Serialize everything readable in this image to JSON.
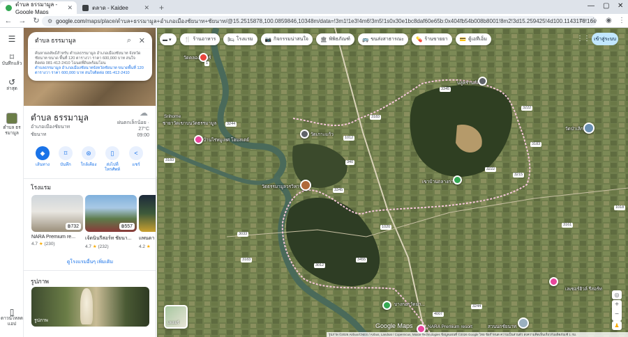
{
  "browser": {
    "tabs": [
      {
        "title": "ตำบล ธรรมามูล - Google Maps",
        "favicon_color": "#34a853",
        "active": true
      },
      {
        "title": "ตลาด - Kaidee",
        "favicon_color": "#3c4043",
        "active": false
      }
    ],
    "new_tab": "+",
    "address": {
      "domain": "google.com",
      "rest": "/maps/place/ตำบล+ธรรมามูล+อำเภอเมืองชัยนาท+ชัยนาท/@15.2515878,100.0859846,10348m/data=!3m1!1e3!4m6!3m5!1s0x30e1bc8daf60e65b:0x404fb54b008b8001!8m2!3d15.259425!4d100.1143176!16s%2Fg%2F1v8syz0r?entry=ttu&g_ep=EgoyMDI..."
    }
  },
  "rail": {
    "menu": "☰",
    "items": [
      {
        "label": "บันทึกแล้ว",
        "icon": "bookmark-icon",
        "glyph": "🔖"
      },
      {
        "label": "ล่าสุด",
        "icon": "history-icon",
        "glyph": "↺"
      },
      {
        "label": "ตำบล ธรรมามูล",
        "icon": "place-thumbnail",
        "glyph": "▣"
      },
      {
        "label": "ดาวน์โหลดแอป",
        "icon": "phone-icon",
        "glyph": "▯"
      }
    ]
  },
  "search": {
    "query": "ตำบล ธรรมามูล",
    "suggestion_line1": "ค้นหาผลลัพธ์สำหรับ ตำบลธรรมามูล อำเภอเมืองชัยนาท จังหวัดชัยนาท ขนาด พื้นที่ 120 ตารางวา ราคา 600,000 บาท สนใจติดต่อ 081-412-2410 โฉนดที่ดินพร้อมโอน",
    "suggestion_line2": "ตำบลธรรมามูล อำเภอเมืองชัยนาทจังหวัดชัยนาท ขนาดพื้นที่ 120 ตารางวา ราคา 600,000 บาท สนใจติดต่อ 081-412-2410"
  },
  "place": {
    "title": "ตำบล ธรรมามูล",
    "sub1": "อำเภอเมืองชัยนาท",
    "sub2": "ชัยนาท",
    "weather_label": "ฝนตกเล็กน้อย · 27°C",
    "weather_time": "09:00",
    "actions": [
      {
        "label": "เส้นทาง",
        "icon": "directions-icon",
        "glyph": "◆"
      },
      {
        "label": "บันทึก",
        "icon": "bookmark-icon",
        "glyph": "⌑"
      },
      {
        "label": "ใกล้เคียง",
        "icon": "nearby-icon",
        "glyph": "⊛"
      },
      {
        "label": "ส่งไปที่โทรศัพท์",
        "icon": "send-to-phone-icon",
        "glyph": "▯"
      },
      {
        "label": "แชร์",
        "icon": "share-icon",
        "glyph": "<"
      }
    ]
  },
  "hotels": {
    "heading": "โรงแรม",
    "items": [
      {
        "name": "NARA Premium re...",
        "price": "฿732",
        "rating": "4.7",
        "count": "(230)"
      },
      {
        "name": "เจ้ดนินรีสอร์ท ชัยนา...",
        "price": "฿557",
        "rating": "4.7",
        "count": "(232)"
      },
      {
        "name": "แพนดา",
        "price": "",
        "rating": "4.2",
        "count": ""
      }
    ],
    "more": "ดูโรงแรมอื่นๆ เพิ่มเติม"
  },
  "photos": {
    "heading": "รูปภาพ",
    "label": "รูปภาพ"
  },
  "chips": [
    {
      "label": "ร้านอาหาร",
      "glyph": "🍴",
      "icon": "restaurant-icon"
    },
    {
      "label": "โรงแรม",
      "glyph": "🛏",
      "icon": "hotel-icon"
    },
    {
      "label": "กิจกรรมน่าสนใจ",
      "glyph": "📷",
      "icon": "camera-icon"
    },
    {
      "label": "พิพิธภัณฑ์",
      "glyph": "🏛",
      "icon": "museum-icon"
    },
    {
      "label": "ขนส่งสาธารณะ",
      "glyph": "🚌",
      "icon": "transit-icon"
    },
    {
      "label": "ร้านขายยา",
      "glyph": "💊",
      "icon": "pharmacy-icon"
    },
    {
      "label": "ตู้เอทีเอ็ม",
      "glyph": "💳",
      "icon": "atm-icon"
    }
  ],
  "signin": "เข้าสู่ระบบ",
  "map_labels": [
    {
      "text": "วัดคลองจันทร์",
      "name": "label-wat-khlong-chan"
    },
    {
      "text": "บลูทรานส์สิต",
      "name": "label-blue-transit"
    },
    {
      "text": "Srihome",
      "name": "label-srihome"
    },
    {
      "text": "ชายาวัดเขาบนวัดธรรมามูล",
      "name": "label-chaya"
    },
    {
      "text": "วัดเกาะแก้ว",
      "name": "label-wat-ko-kaew"
    },
    {
      "text": "บ้านไร่หมูเทศ โฮมสเตย์",
      "name": "label-homestay"
    },
    {
      "text": "วัดธรรมามูลวรวิหาร",
      "name": "label-wat-thammamun"
    },
    {
      "text": "เขาบ้านกลางการุณ",
      "name": "label-khao-ban-klang"
    },
    {
      "text": "วัดป่าเลิก",
      "name": "label-wat-pa-loek"
    },
    {
      "text": "NARA Premium resort",
      "name": "label-nara-resort"
    },
    {
      "text": "เลเซอร์ฮิวล์ รีสอร์ท",
      "name": "label-leisure-resort"
    },
    {
      "text": "สวนนกชัยนาท",
      "name": "label-bird-park"
    },
    {
      "text": "บางกอกวัดมา...",
      "name": "label-bangkok"
    },
    {
      "text": "Google Maps",
      "name": "google-maps-logo"
    }
  ],
  "route_shields": [
    "1",
    "3244",
    "3183",
    "1012",
    "3345",
    "3183",
    "340",
    "3222",
    "3215",
    "3183",
    "3345",
    "1020",
    "3033",
    "3222",
    "3161",
    "1018",
    "3455",
    "3012",
    "3183",
    "3244",
    "4007"
  ],
  "layers_label": "เลเยอร์",
  "attribution": "รูปภาพ ©2026 Airbus/CNES / Airbus, Landsat / Copernicus, Maxar Technologies ข้อมูลแผนที่ ©2026 Google   ไทย   ข้อกำหนด   ความเป็นส่วนตัว   ส่งความคิดเห็นเกี่ยวกับผลิตภัณฑ์   1 กม.",
  "colors": {
    "accent": "#1a73e8",
    "signin_bg": "#c2e7ff",
    "boundary": "#f4c7d8"
  }
}
